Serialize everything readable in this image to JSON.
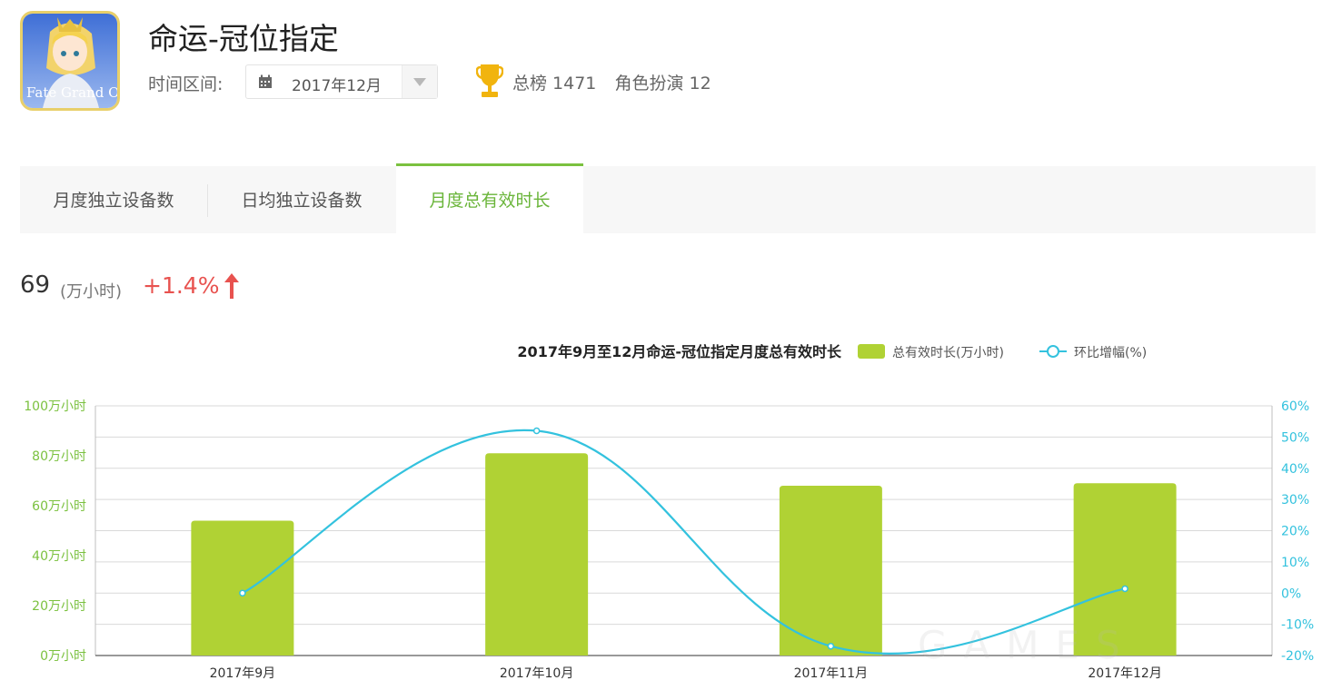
{
  "header": {
    "app_title": "命运-冠位指定",
    "icon_logo_text": "Fate Grand Order",
    "time_label": "时间区间:",
    "date_value": "2017年12月",
    "rank_overall": "总榜 1471",
    "rank_category": "角色扮演 12"
  },
  "tabs": [
    {
      "label": "月度独立设备数"
    },
    {
      "label": "日均独立设备数"
    },
    {
      "label": "月度总有效时长",
      "active": true
    }
  ],
  "kpi": {
    "value": "69",
    "unit": "(万小时)",
    "change": "+1.4%"
  },
  "colors": {
    "bar": "#b0d234",
    "line": "#33c2de",
    "accent": "#7bc13f",
    "up": "#e8524f"
  },
  "chart_data": {
    "type": "bar",
    "title": "2017年9月至12月命运-冠位指定月度总有效时长",
    "categories": [
      "2017年9月",
      "2017年10月",
      "2017年11月",
      "2017年12月"
    ],
    "series": [
      {
        "name": "总有效时长(万小时)",
        "type": "bar",
        "axis": "left",
        "values": [
          54,
          81,
          68,
          69
        ]
      },
      {
        "name": "环比增幅(%)",
        "type": "line",
        "axis": "right",
        "values": [
          0,
          52,
          -17,
          1.4
        ]
      }
    ],
    "y_left": {
      "min": 0,
      "max": 100,
      "ticks": [
        "0万小时",
        "20万小时",
        "40万小时",
        "60万小时",
        "80万小时",
        "100万小时"
      ]
    },
    "y_right": {
      "min": -20,
      "max": 60,
      "ticks": [
        "-20%",
        "-10%",
        "0%",
        "10%",
        "20%",
        "30%",
        "40%",
        "50%",
        "60%"
      ]
    },
    "grid": true,
    "legend_position": "top-right"
  }
}
